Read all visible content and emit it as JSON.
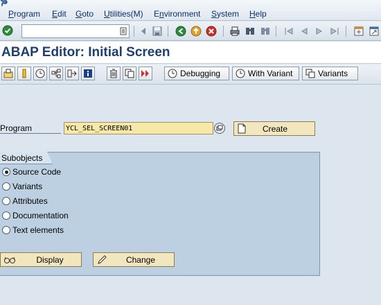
{
  "menubar": {
    "items": [
      {
        "label": "Program",
        "underline": "P",
        "rest": "rogram"
      },
      {
        "label": "Edit",
        "underline": "E",
        "rest": "dit"
      },
      {
        "label": "Goto",
        "underline": "G",
        "rest": "oto"
      },
      {
        "label": "Utilities(M)",
        "underline": "U",
        "rest": "tilities(M)"
      },
      {
        "label": "Environment",
        "underline": "n",
        "rest_pre": "E",
        "rest": "vironment"
      },
      {
        "label": "System",
        "underline": "S",
        "rest": "ystem"
      },
      {
        "label": "Help",
        "underline": "H",
        "rest": "elp"
      }
    ]
  },
  "command_field": {
    "value": ""
  },
  "title": "ABAP Editor: Initial Screen",
  "app_toolbar": {
    "debugging_label": "Debugging",
    "with_variant_label": "With Variant",
    "variants_label": "Variants"
  },
  "program": {
    "label": "Program",
    "value": "YCL_SEL_SCREEN01",
    "create_label": "Create"
  },
  "subobjects": {
    "title": "Subobjects",
    "options": [
      {
        "label": "Source Code",
        "selected": true
      },
      {
        "label": "Variants",
        "selected": false
      },
      {
        "label": "Attributes",
        "selected": false
      },
      {
        "label": "Documentation",
        "selected": false
      },
      {
        "label": "Text elements",
        "selected": false
      }
    ],
    "display_label": "Display",
    "change_label": "Change"
  },
  "colors": {
    "background": "#dde6ee",
    "title_text": "#1e3f6f",
    "group_fill": "#bcd0e1",
    "button_fill": "#f2e6bf",
    "required_field": "#f6e8a6"
  }
}
